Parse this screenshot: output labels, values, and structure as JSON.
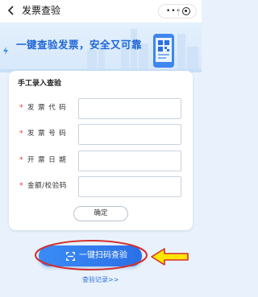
{
  "nav": {
    "title": "发票查验",
    "back_icon": "back-arrow-icon",
    "more_icon": "more-dots-icon",
    "close_icon": "target-circle-icon"
  },
  "banner": {
    "slogan": "一键查验发票，安全又可靠",
    "accent": "#1e66d8"
  },
  "form": {
    "title": "手工录入查验",
    "required_mark": "*",
    "fields": [
      {
        "label": "发票代码",
        "value": ""
      },
      {
        "label": "发票号码",
        "value": ""
      },
      {
        "label": "开票日期",
        "value": ""
      },
      {
        "label": "金额/校验码",
        "value": ""
      }
    ],
    "confirm_label": "确定"
  },
  "scan_button": {
    "label": "一键扫码查验",
    "color": "#2b6fe6"
  },
  "annotation": {
    "ellipse_color": "#d32f2f",
    "arrow_fill": "#ffe600",
    "arrow_stroke": "#d32f2f"
  },
  "records_link": "查验记录>>"
}
